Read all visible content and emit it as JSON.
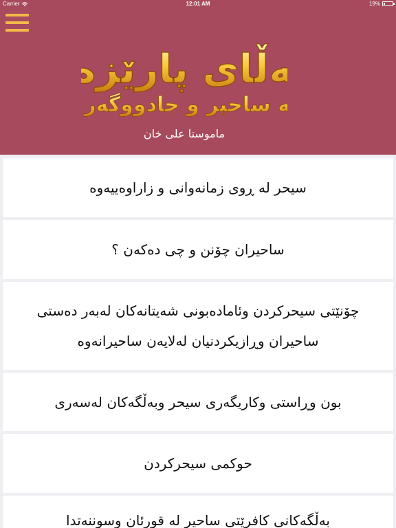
{
  "status_bar": {
    "carrier": "Carrier",
    "time": "12:01 AM",
    "battery": "19%",
    "battery_level": 0.19
  },
  "header": {
    "menu_icon": "hamburger-menu-icon",
    "logo": {
      "title": "قەڵای پارێزەر",
      "subtitle": "لە ساحیر و جادووگەر",
      "author": "ماموستا علی خان"
    },
    "colors": {
      "background": "#a84a5d",
      "accent": "#f2b94a"
    }
  },
  "items": [
    {
      "label": "سیحر لە ڕوی زمانەوانی و زاراوەییەوە"
    },
    {
      "label": "ساحیران چۆنن و چی دەکەن ؟"
    },
    {
      "label": "چۆنێتی سیحرکردن وئامادەبونی شەیتانەکان لەبەر دەستی ساحیران وڕازیکردنیان لەلایەن ساحیرانەوە"
    },
    {
      "label": "بون وڕاستی وکاریگەری سیحر وبەڵگەکان لەسەری"
    },
    {
      "label": "حوکمی سیحرکردن"
    },
    {
      "label": "بەڵگەکانی کافرێتی ساحیر لە قورئان وسوننەتدا"
    }
  ]
}
